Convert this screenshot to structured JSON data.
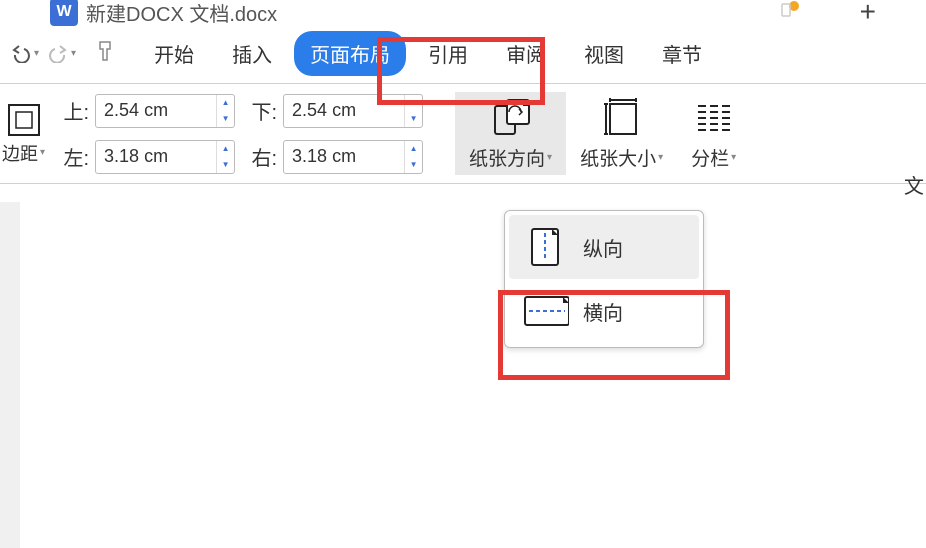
{
  "titlebar": {
    "doc_badge": "W",
    "doc_title": "新建DOCX 文档.docx",
    "plus": "+"
  },
  "menubar": {
    "items": [
      "开始",
      "插入",
      "页面布局",
      "引用",
      "审阅",
      "视图",
      "章节"
    ],
    "active_index": 2
  },
  "margins": {
    "group_label": "边距",
    "top_label": "上:",
    "bottom_label": "下:",
    "left_label": "左:",
    "right_label": "右:",
    "top_value": "2.54 cm",
    "bottom_value": "2.54 cm",
    "left_value": "3.18 cm",
    "right_value": "3.18 cm"
  },
  "ribbon": {
    "orientation": "纸张方向",
    "size": "纸张大小",
    "columns": "分栏",
    "text_cut": "文"
  },
  "orientation_dropdown": {
    "portrait": "纵向",
    "landscape": "横向"
  },
  "colors": {
    "accent": "#2b7de9",
    "highlight": "#e53935"
  }
}
